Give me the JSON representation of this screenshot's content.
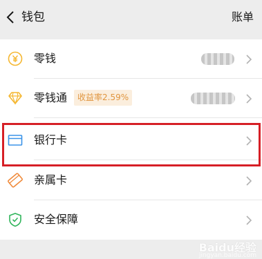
{
  "header": {
    "title": "钱包",
    "action_label": "账单"
  },
  "rows": [
    {
      "label": "零钱",
      "icon": "yuan-coin-icon",
      "value_masked": true
    },
    {
      "label": "零钱通",
      "icon": "diamond-icon",
      "badge": "收益率2.59%",
      "value_masked": true
    },
    {
      "label": "银行卡",
      "icon": "bank-card-icon",
      "highlighted": true
    },
    {
      "label": "亲属卡",
      "icon": "family-card-icon"
    },
    {
      "label": "安全保障",
      "icon": "shield-check-icon"
    }
  ],
  "colors": {
    "accent_yellow": "#f5b731",
    "card_blue": "#3a93e8",
    "shield_green": "#2fb45a",
    "family_orange": "#f08a3a",
    "highlight_red": "#d61f26",
    "badge_text": "#e0953f",
    "badge_bg": "#fbeedd"
  },
  "watermark": {
    "text": "Baidu经验",
    "sub": "jingyan.baidu.com"
  }
}
